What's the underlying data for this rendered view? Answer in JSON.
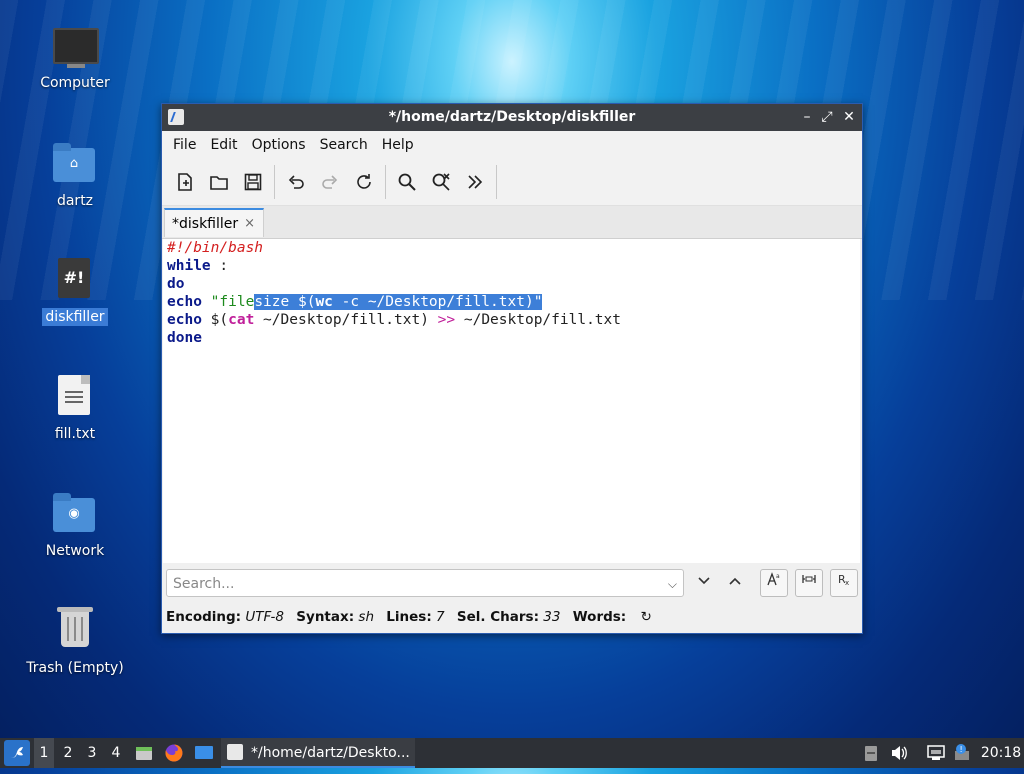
{
  "desktop": {
    "icons": [
      {
        "label": "Computer",
        "icon": "computer-icon"
      },
      {
        "label": "dartz",
        "icon": "home-folder-icon"
      },
      {
        "label": "diskfiller",
        "icon": "script-file-icon",
        "selected": true
      },
      {
        "label": "fill.txt",
        "icon": "text-file-icon"
      },
      {
        "label": "Network",
        "icon": "network-folder-icon"
      },
      {
        "label": "Trash (Empty)",
        "icon": "trash-icon"
      }
    ]
  },
  "window": {
    "title": "*/home/dartz/Desktop/diskfiller",
    "controls": {
      "minimize": "–",
      "maximize": "⤢",
      "close": "✕"
    },
    "menu": [
      "File",
      "Edit",
      "Options",
      "Search",
      "Help"
    ],
    "toolbar": [
      "new-document-icon",
      "open-folder-icon",
      "save-icon",
      "undo-icon",
      "redo-icon",
      "reload-icon",
      "find-icon",
      "find-replace-icon",
      "more-icon"
    ],
    "tab": {
      "label": "*diskfiller",
      "close": "×"
    },
    "code": {
      "l1": "#!/bin/bash",
      "l2_kw": "while",
      "l2_rest": " :",
      "l3": "do",
      "l4_kw": "echo",
      "l4_sp": " ",
      "l4_str_a": "\"file",
      "l4_sel_a": "size ",
      "l4_sel_b": "$(",
      "l4_sel_c": "wc",
      "l4_sel_d": " -c ~/Desktop/fill.txt)\"",
      "l5_kw": "echo",
      "l5_a": " ",
      "l5_b": "$(",
      "l5_c": "cat",
      "l5_d": " ~/Desktop/fill.txt) ",
      "l5_e": ">>",
      "l5_f": " ~/Desktop/fill.txt",
      "l6": "done"
    },
    "search": {
      "placeholder": "Search...",
      "dropdown": "⌵"
    },
    "status": {
      "encoding_label": "Encoding:",
      "encoding": "UTF-8",
      "syntax_label": "Syntax:",
      "syntax": "sh",
      "lines_label": "Lines:",
      "lines": "7",
      "selchars_label": "Sel. Chars:",
      "selchars": "33",
      "words_label": "Words:",
      "refresh": "↻"
    }
  },
  "taskbar": {
    "workspaces": [
      "1",
      "2",
      "3",
      "4"
    ],
    "task": "*/home/dartz/Deskto...",
    "clock": "20:18"
  }
}
